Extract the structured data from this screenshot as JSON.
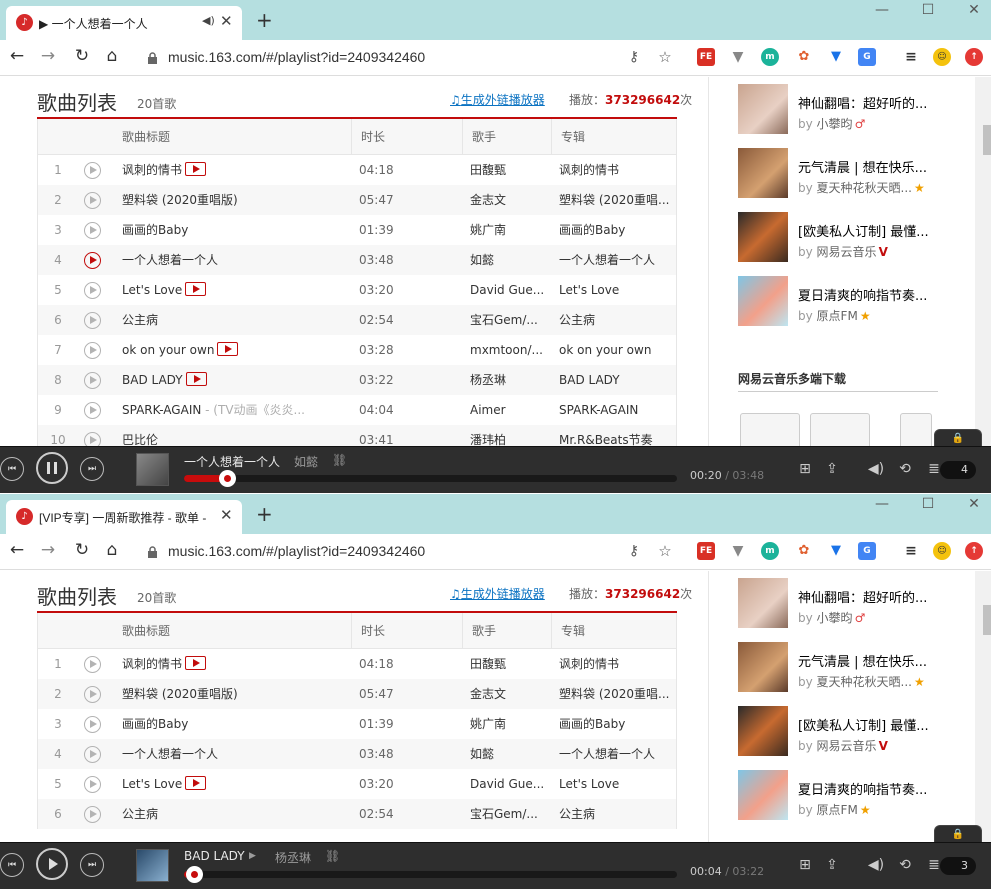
{
  "windows": [
    {
      "tab_title": "▶ 一个人想着一个人",
      "url": "music.163.com/#/playlist?id=2409342460",
      "header": {
        "title": "歌曲列表",
        "count": "20首歌",
        "gen_link": "生成外链播放器",
        "play_label": "播放：",
        "play_num": "373296642",
        "play_unit": "次"
      },
      "columns": [
        "歌曲标题",
        "时长",
        "歌手",
        "专辑"
      ],
      "rows": [
        {
          "idx": "1",
          "title": "讽刺的情书",
          "sub": "",
          "mv": true,
          "dur": "04:18",
          "artist": "田馥甄",
          "album": "讽刺的情书",
          "active": false
        },
        {
          "idx": "2",
          "title": "塑料袋 (2020重唱版)",
          "sub": "",
          "mv": false,
          "dur": "05:47",
          "artist": "金志文",
          "album": "塑料袋 (2020重唱...",
          "active": false
        },
        {
          "idx": "3",
          "title": "画画的Baby",
          "sub": "",
          "mv": false,
          "dur": "01:39",
          "artist": "姚广南",
          "album": "画画的Baby",
          "active": false
        },
        {
          "idx": "4",
          "title": "一个人想着一个人",
          "sub": "",
          "mv": false,
          "dur": "03:48",
          "artist": "如懿",
          "album": "一个人想着一个人",
          "active": true
        },
        {
          "idx": "5",
          "title": "Let's Love",
          "sub": "",
          "mv": true,
          "dur": "03:20",
          "artist": "David Gue...",
          "album": "Let's Love",
          "active": false
        },
        {
          "idx": "6",
          "title": "公主病",
          "sub": "",
          "mv": false,
          "dur": "02:54",
          "artist": "宝石Gem/...",
          "album": "公主病",
          "active": false
        },
        {
          "idx": "7",
          "title": "ok on your own",
          "sub": "",
          "mv": true,
          "dur": "03:28",
          "artist": "mxmtoon/...",
          "album": "ok on your own",
          "active": false
        },
        {
          "idx": "8",
          "title": "BAD LADY",
          "sub": "",
          "mv": true,
          "dur": "03:22",
          "artist": "杨丞琳",
          "album": "BAD LADY",
          "active": false
        },
        {
          "idx": "9",
          "title": "SPARK-AGAIN",
          "sub": " - (TV动画《炎炎...",
          "mv": false,
          "dur": "04:04",
          "artist": "Aimer",
          "album": "SPARK-AGAIN",
          "active": false
        },
        {
          "idx": "10",
          "title": "巴比伦",
          "sub": "",
          "mv": false,
          "dur": "03:41",
          "artist": "潘玮柏",
          "album": "Mr.R&Beats节奏",
          "active": false
        }
      ],
      "side": [
        {
          "title": "神仙翻唱：超好听的...",
          "by": "by",
          "name": "小攀昀",
          "badge": "♂"
        },
        {
          "title": "元气清晨 | 想在快乐...",
          "by": "by",
          "name": "夏天种花秋天晒...",
          "badge": "★"
        },
        {
          "title": "[欧美私人订制] 最懂...",
          "by": "by",
          "name": "网易云音乐",
          "badge": "V"
        },
        {
          "title": "夏日清爽的响指节奏...",
          "by": "by",
          "name": "原点FM",
          "badge": "★"
        }
      ],
      "download_title": "网易云音乐多端下载",
      "player": {
        "title": "一个人想着一个人",
        "artist": "如懿",
        "elapsed": "00:20",
        "total": "/ 03:48",
        "progress": 0.088,
        "count": "4",
        "playing": true
      }
    },
    {
      "tab_title": "[VIP专享] 一周新歌推荐 - 歌单 -",
      "url": "music.163.com/#/playlist?id=2409342460",
      "header": {
        "title": "歌曲列表",
        "count": "20首歌",
        "gen_link": "生成外链播放器",
        "play_label": "播放：",
        "play_num": "373296642",
        "play_unit": "次"
      },
      "columns": [
        "歌曲标题",
        "时长",
        "歌手",
        "专辑"
      ],
      "rows": [
        {
          "idx": "1",
          "title": "讽刺的情书",
          "sub": "",
          "mv": true,
          "dur": "04:18",
          "artist": "田馥甄",
          "album": "讽刺的情书",
          "active": false
        },
        {
          "idx": "2",
          "title": "塑料袋 (2020重唱版)",
          "sub": "",
          "mv": false,
          "dur": "05:47",
          "artist": "金志文",
          "album": "塑料袋 (2020重唱...",
          "active": false
        },
        {
          "idx": "3",
          "title": "画画的Baby",
          "sub": "",
          "mv": false,
          "dur": "01:39",
          "artist": "姚广南",
          "album": "画画的Baby",
          "active": false
        },
        {
          "idx": "4",
          "title": "一个人想着一个人",
          "sub": "",
          "mv": false,
          "dur": "03:48",
          "artist": "如懿",
          "album": "一个人想着一个人",
          "active": false
        },
        {
          "idx": "5",
          "title": "Let's Love",
          "sub": "",
          "mv": true,
          "dur": "03:20",
          "artist": "David Gue...",
          "album": "Let's Love",
          "active": false
        },
        {
          "idx": "6",
          "title": "公主病",
          "sub": "",
          "mv": false,
          "dur": "02:54",
          "artist": "宝石Gem/...",
          "album": "公主病",
          "active": false
        }
      ],
      "side": [
        {
          "title": "神仙翻唱：超好听的...",
          "by": "by",
          "name": "小攀昀",
          "badge": "♂"
        },
        {
          "title": "元气清晨 | 想在快乐...",
          "by": "by",
          "name": "夏天种花秋天晒...",
          "badge": "★"
        },
        {
          "title": "[欧美私人订制] 最懂...",
          "by": "by",
          "name": "网易云音乐",
          "badge": "V"
        },
        {
          "title": "夏日清爽的响指节奏...",
          "by": "by",
          "name": "原点FM",
          "badge": "★"
        }
      ],
      "download_title": "",
      "player": {
        "title": "BAD LADY",
        "artist": "杨丞琳",
        "elapsed": "00:04",
        "total": "/ 03:22",
        "progress": 0.02,
        "count": "3",
        "playing": false
      }
    }
  ],
  "colors": {
    "accent": "#c20c0c",
    "link": "#0c73c2",
    "titlebar": "#b5dfe0",
    "player_bg": "#2e2e2e"
  }
}
